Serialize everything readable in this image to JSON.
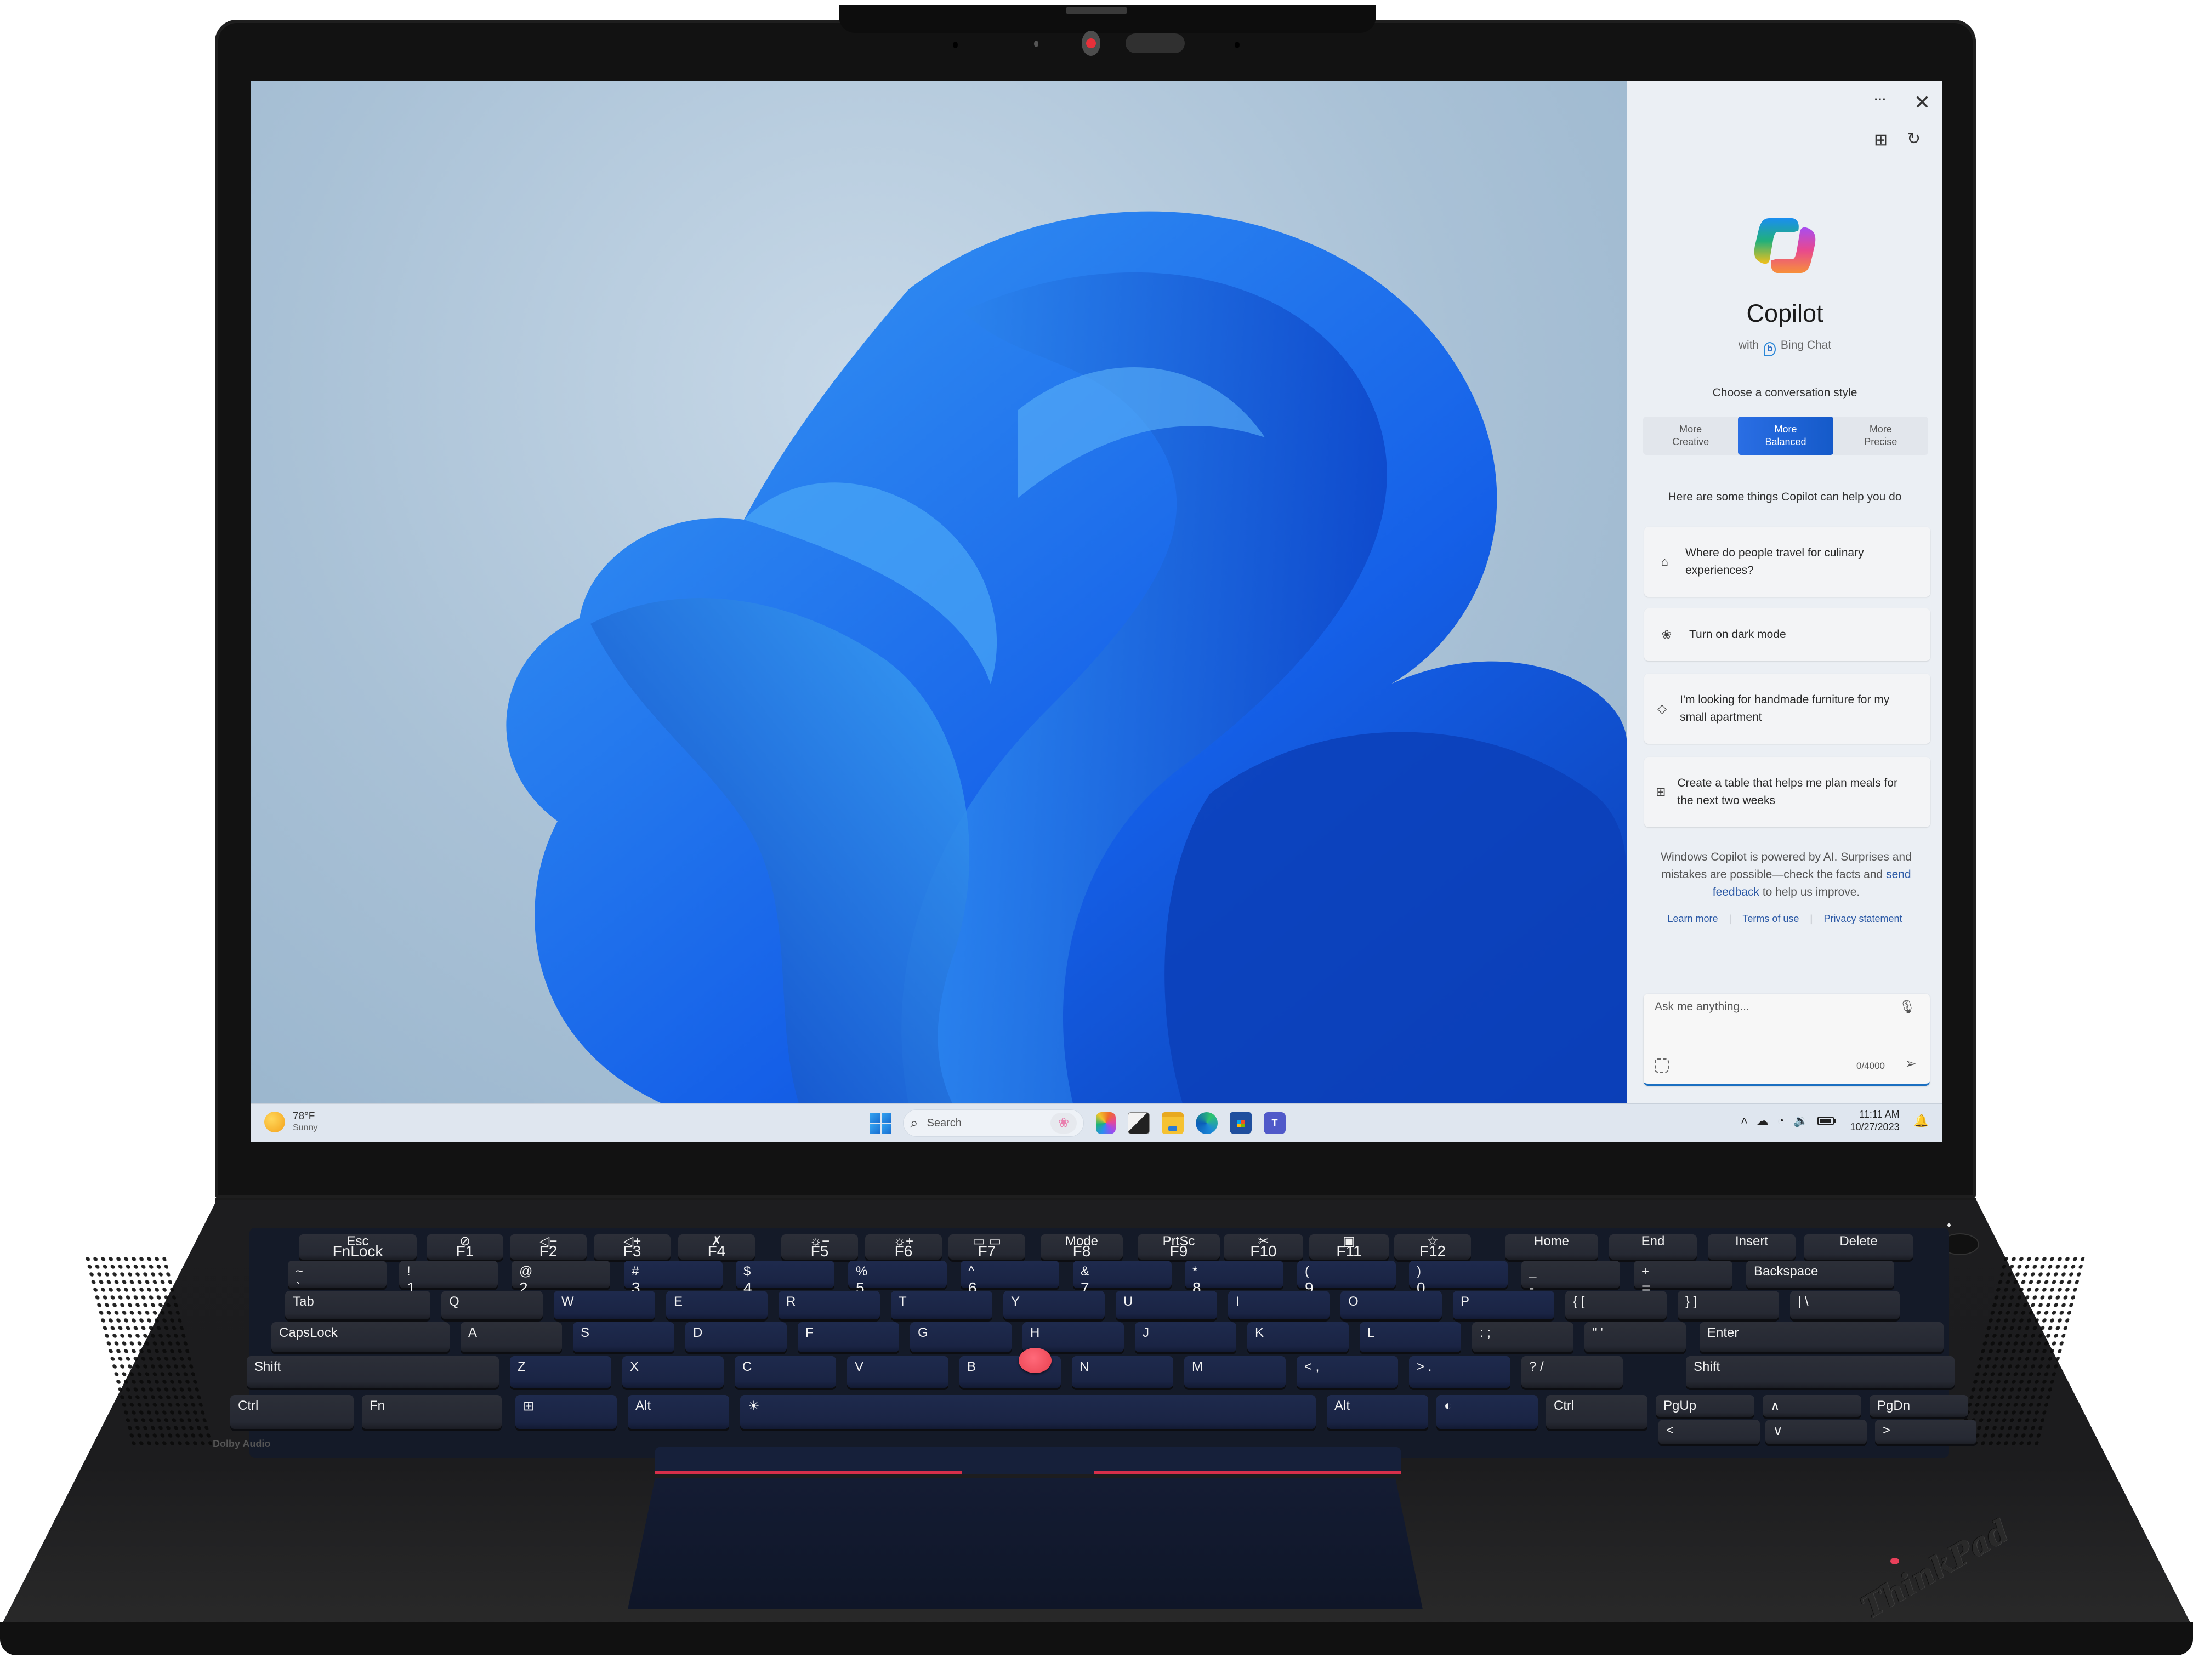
{
  "copilot": {
    "more_menu": "⋯",
    "close": "✕",
    "widgets_icon": "⊞",
    "history_icon": "↻",
    "title": "Copilot",
    "subtitle_prefix": "with",
    "subtitle_brand_icon": "b",
    "subtitle_brand": "Bing Chat",
    "choose_style": "Choose a conversation style",
    "styles": [
      {
        "line1": "More",
        "line2": "Creative",
        "selected": false
      },
      {
        "line1": "More",
        "line2": "Balanced",
        "selected": true
      },
      {
        "line1": "More",
        "line2": "Precise",
        "selected": false
      }
    ],
    "help_heading": "Here are some things Copilot can help you do",
    "suggestions": [
      {
        "icon": "briefcase-icon",
        "glyph": "⌂",
        "text": "Where do people travel for culinary experiences?"
      },
      {
        "icon": "palette-icon",
        "glyph": "❀",
        "text": "Turn on dark mode"
      },
      {
        "icon": "tag-icon",
        "glyph": "◇",
        "text": "I'm looking for handmade furniture for my small apartment"
      },
      {
        "icon": "table-icon",
        "glyph": "⊞",
        "text": "Create a table that helps me plan meals for the next two weeks"
      }
    ],
    "disclaimer_1": "Windows Copilot is powered by AI. Surprises and mistakes are possible—check the facts and",
    "disclaimer_link": "send feedback",
    "disclaimer_2": "to help us improve.",
    "links": [
      "Learn more",
      "Terms of use",
      "Privacy statement"
    ],
    "link_separator": "|",
    "input_placeholder": "Ask me anything...",
    "mic_icon": "🎙",
    "char_count": "0/4000",
    "send_icon": "➢",
    "accent_color": "#1b6fc1"
  },
  "taskbar": {
    "weather_temp": "78°F",
    "weather_condition": "Sunny",
    "search_icon": "⌕",
    "search_label": "Search",
    "search_highlight_icon": "❀",
    "teams_label": "T",
    "tray_overflow_icon": "˄",
    "onedrive_icon": "☁",
    "wifi_icon": "◔",
    "volume_icon": "🔉",
    "time": "11:11 AM",
    "date": "10/27/2023",
    "notification_icon": "🔔"
  },
  "keyboard": {
    "fn_row": [
      {
        "top": "Esc",
        "bot": "FnLock"
      },
      {
        "top": "⊘",
        "bot": "F1"
      },
      {
        "top": "◁−",
        "bot": "F2"
      },
      {
        "top": "◁+",
        "bot": "F3"
      },
      {
        "top": "✗",
        "bot": "F4"
      },
      {
        "top": "☼−",
        "bot": "F5"
      },
      {
        "top": "☼+",
        "bot": "F6"
      },
      {
        "top": "▭ ▭",
        "bot": "F7"
      },
      {
        "top": "Mode",
        "bot": "F8"
      },
      {
        "top": "PrtSc",
        "bot": "F9"
      },
      {
        "top": "✂",
        "bot": "F10"
      },
      {
        "top": "▣",
        "bot": "F11"
      },
      {
        "top": "☆",
        "bot": "F12"
      },
      {
        "top": "Home",
        "bot": ""
      },
      {
        "top": "End",
        "bot": ""
      },
      {
        "top": "Insert",
        "bot": ""
      },
      {
        "top": "Delete",
        "bot": ""
      }
    ],
    "number_row": [
      {
        "top": "~",
        "bot": "`"
      },
      {
        "top": "!",
        "bot": "1"
      },
      {
        "top": "@",
        "bot": "2"
      },
      {
        "top": "#",
        "bot": "3"
      },
      {
        "top": "$",
        "bot": "4"
      },
      {
        "top": "%",
        "bot": "5"
      },
      {
        "top": "^",
        "bot": "6"
      },
      {
        "top": "&",
        "bot": "7"
      },
      {
        "top": "*",
        "bot": "8"
      },
      {
        "top": "(",
        "bot": "9"
      },
      {
        "top": ")",
        "bot": "0"
      },
      {
        "top": "_",
        "bot": "-"
      },
      {
        "top": "+",
        "bot": "="
      },
      {
        "top": "Backspace",
        "bot": ""
      }
    ],
    "qwerty_row": [
      "Tab",
      "Q",
      "W",
      "E",
      "R",
      "T",
      "Y",
      "U",
      "I",
      "O",
      "P",
      "{ [",
      "} ]",
      "| \\"
    ],
    "home_row": [
      "CapsLock",
      "A",
      "S",
      "D",
      "F",
      "G",
      "H",
      "J",
      "K",
      "L",
      ": ;",
      "\" '",
      "Enter"
    ],
    "shift_row": [
      "Shift",
      "Z",
      "X",
      "C",
      "V",
      "B",
      "N",
      "M",
      "< ,",
      "> .",
      "? /",
      "Shift"
    ],
    "bottom_row": [
      "Ctrl",
      "Fn",
      "⊞",
      "Alt",
      "☀",
      "Alt",
      "◐",
      "Ctrl",
      "PgUp",
      "∧",
      "PgDn"
    ],
    "arrow_row": [
      "<",
      "∨",
      ">"
    ]
  },
  "branding": {
    "audio": "Dolby Audio",
    "logo": "ThinkPad",
    "accent_red": "#e8405a"
  }
}
